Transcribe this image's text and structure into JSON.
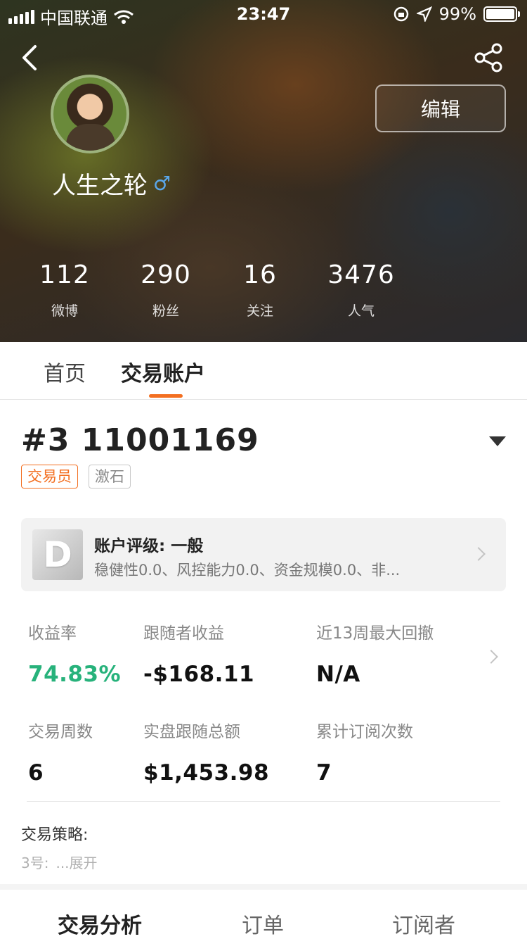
{
  "status_bar": {
    "carrier": "中国联通",
    "time": "23:47",
    "battery_percent": "99%"
  },
  "profile": {
    "edit_label": "编辑",
    "username": "人生之轮",
    "gender_symbol": "♂",
    "stats": [
      {
        "value": "112",
        "label": "微博"
      },
      {
        "value": "290",
        "label": "粉丝"
      },
      {
        "value": "16",
        "label": "关注"
      },
      {
        "value": "3476",
        "label": "人气"
      }
    ]
  },
  "tabs": [
    {
      "label": "首页"
    },
    {
      "label": "交易账户",
      "active": true
    }
  ],
  "account": {
    "id": "#3 11001169",
    "tags": [
      "交易员",
      "激石"
    ],
    "rating": {
      "grade": "D",
      "title": "账户评级: 一般",
      "description": "稳健性0.0、风控能力0.0、资金规模0.0、非..."
    },
    "metrics": [
      {
        "label": "收益率",
        "value": "74.83%"
      },
      {
        "label": "跟随者收益",
        "value": "-$168.11"
      },
      {
        "label": "近13周最大回撤",
        "value": "N/A"
      },
      {
        "label": "交易周数",
        "value": "6"
      },
      {
        "label": "实盘跟随总额",
        "value": "$1,453.98"
      },
      {
        "label": "累计订阅次数",
        "value": "7"
      }
    ],
    "strategy_label": "交易策略:",
    "strategy_text": "3号:",
    "strategy_more": "...展开"
  },
  "bottom_tabs": [
    {
      "label": "交易分析",
      "active": true
    },
    {
      "label": "订单"
    },
    {
      "label": "订阅者"
    }
  ],
  "colors": {
    "accent": "#f36f21",
    "positive": "#27b27b"
  }
}
